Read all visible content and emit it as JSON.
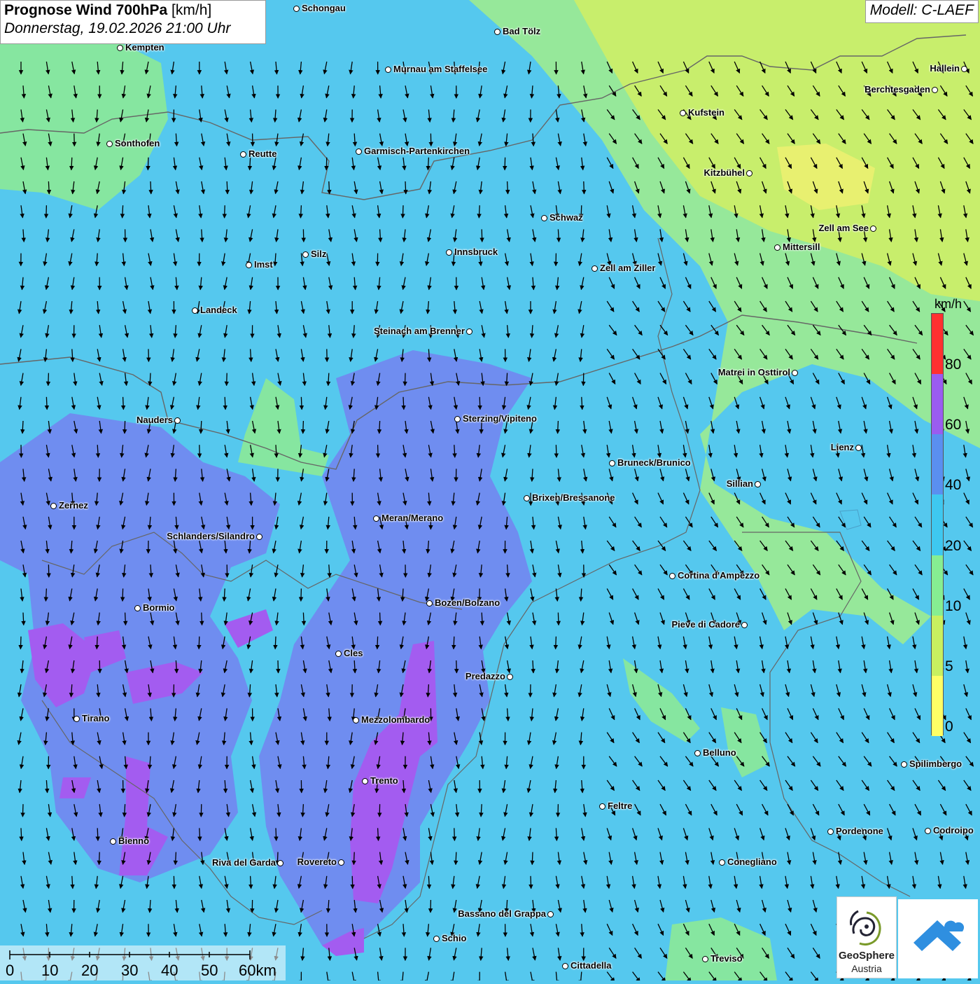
{
  "header": {
    "title_bold": "Prognose Wind 700hPa",
    "title_unit": "[km/h]",
    "datetime": "Donnerstag, 19.02.2026 21:00 Uhr"
  },
  "model": "Modell: C-LAEF",
  "legend": {
    "unit": "km/h",
    "classes": [
      {
        "label": "0",
        "color": "#ffff66"
      },
      {
        "label": "5",
        "color": "#c8f060"
      },
      {
        "label": "10",
        "color": "#86ee92"
      },
      {
        "label": "20",
        "color": "#3ec8f0"
      },
      {
        "label": "40",
        "color": "#5a8ff0"
      },
      {
        "label": "60",
        "color": "#9a5cf0"
      },
      {
        "label": "80",
        "color": "#ff3030"
      }
    ]
  },
  "scale": {
    "labels": [
      "0",
      "10",
      "20",
      "30",
      "40",
      "50",
      "60km"
    ]
  },
  "cities": [
    {
      "name": "Schongau"
    },
    {
      "name": "Bad Tölz"
    },
    {
      "name": "Kempten"
    },
    {
      "name": "Murnau am Staffelsee"
    },
    {
      "name": "Hallein"
    },
    {
      "name": "Berchtesgaden"
    },
    {
      "name": "Kufstein"
    },
    {
      "name": "Sonthofen"
    },
    {
      "name": "Reutte"
    },
    {
      "name": "Garmisch-Partenkirchen"
    },
    {
      "name": "Kitzbühel"
    },
    {
      "name": "Schwaz"
    },
    {
      "name": "Zell am See"
    },
    {
      "name": "Mittersill"
    },
    {
      "name": "Silz"
    },
    {
      "name": "Innsbruck"
    },
    {
      "name": "Imst"
    },
    {
      "name": "Zell am Ziller"
    },
    {
      "name": "Landeck"
    },
    {
      "name": "Steinach am Brenner"
    },
    {
      "name": "Matrei in Osttirol"
    },
    {
      "name": "Nauders"
    },
    {
      "name": "Sterzing/Vipiteno"
    },
    {
      "name": "Lienz"
    },
    {
      "name": "Bruneck/Brunico"
    },
    {
      "name": "Sillian"
    },
    {
      "name": "Brixen/Bressanone"
    },
    {
      "name": "Zernez"
    },
    {
      "name": "Meran/Merano"
    },
    {
      "name": "Schlanders/Silandro"
    },
    {
      "name": "Cortina d'Ampezzo"
    },
    {
      "name": "Bozen/Bolzano"
    },
    {
      "name": "Pieve di Cadore"
    },
    {
      "name": "Bormio"
    },
    {
      "name": "Cles"
    },
    {
      "name": "Predazzo"
    },
    {
      "name": "Tirano"
    },
    {
      "name": "Mezzolombardo"
    },
    {
      "name": "Belluno"
    },
    {
      "name": "Spilimbergo"
    },
    {
      "name": "Trento"
    },
    {
      "name": "Feltre"
    },
    {
      "name": "Pordenone"
    },
    {
      "name": "Codroipo"
    },
    {
      "name": "Bienno"
    },
    {
      "name": "Riva del Garda"
    },
    {
      "name": "Rovereto"
    },
    {
      "name": "Conegliano"
    },
    {
      "name": "Bassano del Grappa"
    },
    {
      "name": "Schio"
    },
    {
      "name": "Treviso"
    },
    {
      "name": "Cittadella"
    }
  ],
  "logos": {
    "geosphere_name": "GeoSphere",
    "geosphere_sub": "Austria"
  },
  "icons": {
    "wind_arrow": "wind-direction-arrow-icon",
    "geosphere_logo": "geosphere-logo-icon",
    "partner_logo": "cloud-chevron-logo-icon"
  }
}
